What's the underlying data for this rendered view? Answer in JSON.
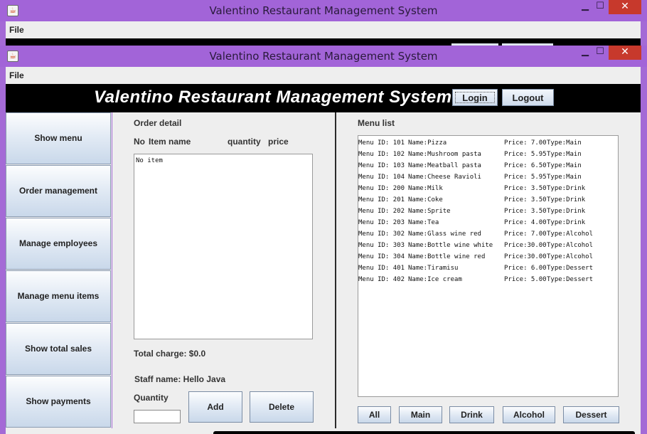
{
  "window_back": {
    "title": "Valentino Restaurant Management System",
    "menu_file": "File"
  },
  "window": {
    "title": "Valentino Restaurant Management System",
    "menu_file": "File",
    "minimize": "▭",
    "maximize": "☐",
    "close": "✕"
  },
  "header": {
    "title": "Valentino Restaurant Management System",
    "login": "Login",
    "logout": "Logout"
  },
  "nav": {
    "items": [
      {
        "label": "Show menu"
      },
      {
        "label": "Order management"
      },
      {
        "label": "Manage employees"
      },
      {
        "label": "Manage menu items"
      },
      {
        "label": "Show total sales"
      },
      {
        "label": "Show payments"
      }
    ]
  },
  "order": {
    "title": "Order detail",
    "col_no": "No",
    "col_item": "Item name",
    "col_qty": "quantity",
    "col_price": "price",
    "content": "No item",
    "total_label": "Total charge: $0.0",
    "staff_label": "Staff name: Hello Java",
    "quantity_label": "Quantity",
    "quantity_value": "",
    "add": "Add",
    "delete": "Delete"
  },
  "menu": {
    "title": "Menu list",
    "rows": [
      {
        "id": "Menu ID: 101",
        "name": "Name:Pizza",
        "price": "Price: 7.00",
        "type": "Type:Main"
      },
      {
        "id": "Menu ID: 102",
        "name": "Name:Mushroom pasta",
        "price": "Price: 5.95",
        "type": "Type:Main"
      },
      {
        "id": "Menu ID: 103",
        "name": "Name:Meatball pasta",
        "price": "Price: 6.50",
        "type": "Type:Main"
      },
      {
        "id": "Menu ID: 104",
        "name": "Name:Cheese Ravioli",
        "price": "Price: 5.95",
        "type": "Type:Main"
      },
      {
        "id": "Menu ID: 200",
        "name": "Name:Milk",
        "price": "Price: 3.50",
        "type": "Type:Drink"
      },
      {
        "id": "Menu ID: 201",
        "name": "Name:Coke",
        "price": "Price: 3.50",
        "type": "Type:Drink"
      },
      {
        "id": "Menu ID: 202",
        "name": "Name:Sprite",
        "price": "Price: 3.50",
        "type": "Type:Drink"
      },
      {
        "id": "Menu ID: 203",
        "name": "Name:Tea",
        "price": "Price: 4.00",
        "type": "Type:Drink"
      },
      {
        "id": "Menu ID: 302",
        "name": "Name:Glass wine red",
        "price": "Price: 7.00",
        "type": "Type:Alcohol"
      },
      {
        "id": "Menu ID: 303",
        "name": "Name:Bottle wine white",
        "price": "Price:30.00",
        "type": "Type:Alcohol"
      },
      {
        "id": "Menu ID: 304",
        "name": "Name:Bottle wine red",
        "price": "Price:30.00",
        "type": "Type:Alcohol"
      },
      {
        "id": "Menu ID: 401",
        "name": "Name:Tiramisu",
        "price": "Price: 6.00",
        "type": "Type:Dessert"
      },
      {
        "id": "Menu ID: 402",
        "name": "Name:Ice cream",
        "price": "Price: 5.00",
        "type": "Type:Dessert"
      }
    ],
    "filters": {
      "all": "All",
      "main": "Main",
      "drink": "Drink",
      "alcohol": "Alcohol",
      "dessert": "Dessert"
    }
  },
  "colors": {
    "titlebar": "#a264d8",
    "close": "#c7392c",
    "header": "#000000",
    "panel": "#eeeeee"
  }
}
